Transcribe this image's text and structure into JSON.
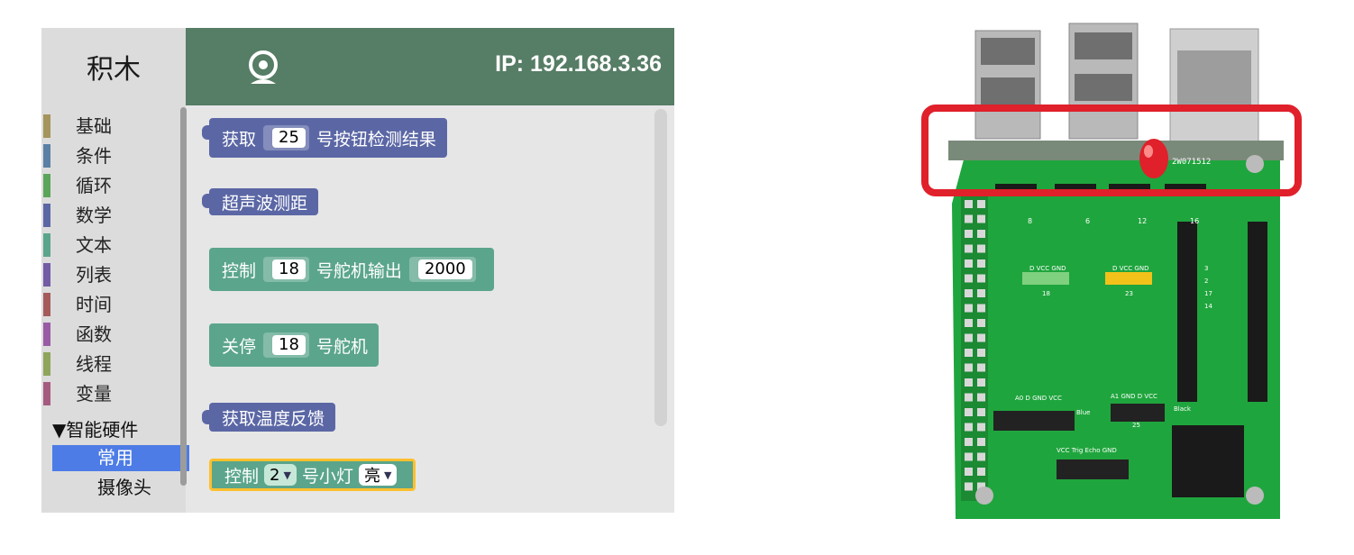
{
  "editor": {
    "tab_label": "积木",
    "ip_label": "IP: 192.168.3.36",
    "camera_icon": "webcam-icon",
    "header_color": "#567d65",
    "categories": [
      {
        "label": "基础",
        "color": "#a5945b"
      },
      {
        "label": "条件",
        "color": "#5b80a5"
      },
      {
        "label": "循环",
        "color": "#5ba55b"
      },
      {
        "label": "数学",
        "color": "#5b67a5"
      },
      {
        "label": "文本",
        "color": "#5ba58c"
      },
      {
        "label": "列表",
        "color": "#745ba5"
      },
      {
        "label": "时间",
        "color": "#a55b5b"
      },
      {
        "label": "函数",
        "color": "#995ba5"
      },
      {
        "label": "线程",
        "color": "#8ea55b"
      },
      {
        "label": "变量",
        "color": "#a55b80"
      }
    ],
    "hardware_category": "▼智能硬件",
    "hardware_sub_selected": "常用",
    "hardware_sub_other": "摄像头",
    "blocks": {
      "b1_prefix": "获取",
      "b1_value": "25",
      "b1_suffix": "号按钮检测结果",
      "b2_text": "超声波测距",
      "b3_prefix": "控制",
      "b3_value1": "18",
      "b3_mid": "号舵机输出",
      "b3_value2": "2000",
      "b4_prefix": "关停",
      "b4_value": "18",
      "b4_suffix": "号舵机",
      "b5_text": "获取温度反馈",
      "b6_prefix": "控制",
      "b6_dd1": "2",
      "b6_mid": "号小灯",
      "b6_dd2": "亮"
    },
    "block_colors": {
      "purple": "#5b67a5",
      "teal": "#5ba58c",
      "highlight": "#ffc02d"
    }
  },
  "photo": {
    "board_labels": [
      "2W071512",
      "8",
      "6",
      "12",
      "16",
      "D VCC GND",
      "D VCC GND",
      "18",
      "23",
      "3",
      "2",
      "17",
      "14",
      "A0 D GND VCC",
      "A1 GND D VCC",
      "Blue",
      "Black",
      "25",
      "VCC Trig Echo GND"
    ],
    "highlight_color": "#e0202a",
    "led_color": "#e0202a"
  }
}
